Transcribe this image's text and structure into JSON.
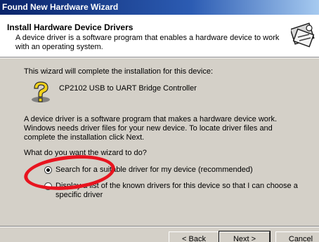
{
  "window": {
    "title": "Found New Hardware Wizard"
  },
  "header": {
    "title": "Install Hardware Device Drivers",
    "description": "A device driver is a software program that enables a hardware device to work with an operating system.",
    "icon": "hardware-wizard-icon"
  },
  "body": {
    "intro": "This wizard will complete the installation for this device:",
    "device_icon": "unknown-device-question-icon",
    "device_name": "CP2102 USB to UART Bridge Controller",
    "explanation": "A device driver is a software program that makes a hardware device work. Windows needs driver files for your new device. To locate driver files and complete the installation click Next.",
    "question": "What do you want the wizard to do?",
    "options": [
      {
        "label": "Search for a suitable driver for my device (recommended)",
        "selected": true
      },
      {
        "label": "Display a list of the known drivers for this device so that I can choose a specific driver",
        "selected": false
      }
    ]
  },
  "annotation": {
    "color": "#e8141f"
  },
  "buttons": {
    "back": "< Back",
    "next": "Next >",
    "cancel": "Cancel"
  }
}
